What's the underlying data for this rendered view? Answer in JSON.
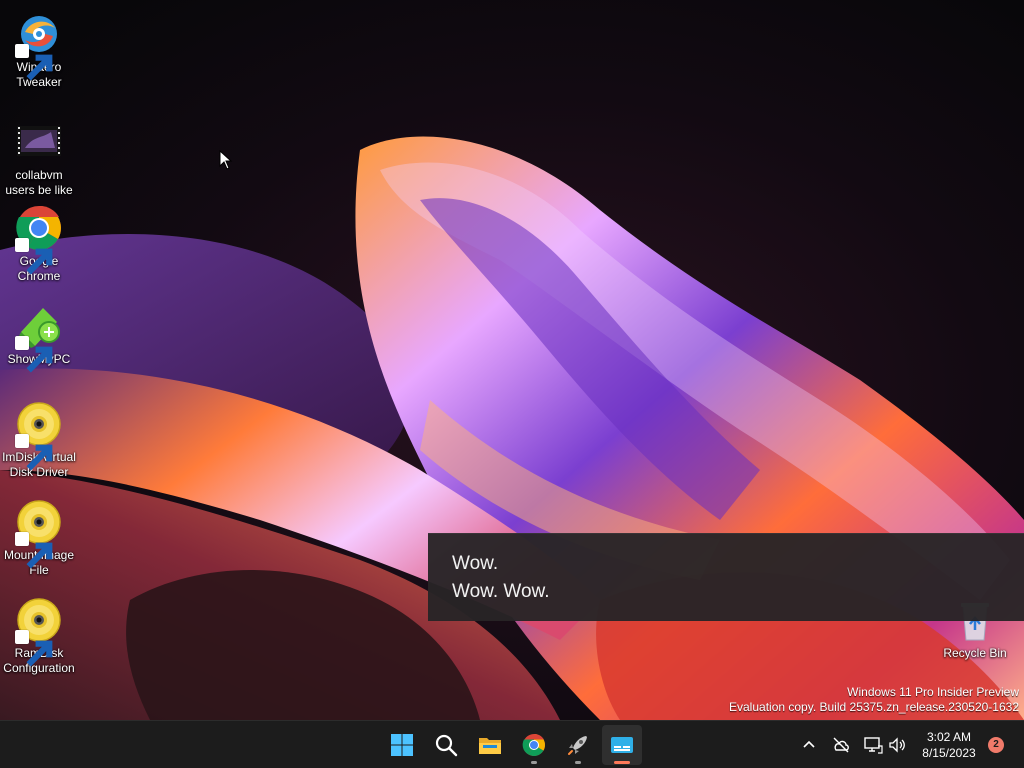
{
  "desktop": {
    "icons": [
      {
        "name": "winaero-tweaker",
        "label": "Winaero\nTweaker",
        "icon": "winaero-tweaker-icon"
      },
      {
        "name": "collabvm-video",
        "label": "collabvm\nusers be like",
        "icon": "video-thumbnail-icon"
      },
      {
        "name": "google-chrome",
        "label": "Google\nChrome",
        "icon": "chrome-icon"
      },
      {
        "name": "showmypc",
        "label": "ShowMyPC",
        "icon": "showmypc-icon"
      },
      {
        "name": "imdisk-virtual-disk-driver",
        "label": "ImDisk Virtual\nDisk Driver",
        "icon": "disc-icon"
      },
      {
        "name": "mount-image-file",
        "label": "Mount Image\nFile",
        "icon": "disc-icon"
      },
      {
        "name": "ramdisk-configuration",
        "label": "RamDisk\nConfiguration",
        "icon": "disc-icon"
      }
    ],
    "recycle_bin": {
      "label": "Recycle Bin",
      "icon": "recycle-bin-icon"
    }
  },
  "caption": {
    "line1": "Wow.",
    "line2": "Wow. Wow."
  },
  "watermark": {
    "line1": "Windows 11 Pro Insider Preview",
    "line2": "Evaluation copy. Build 25375.zn_release.230520-1632"
  },
  "taskbar": {
    "apps": [
      {
        "name": "start",
        "icon": "windows-start-icon"
      },
      {
        "name": "search",
        "icon": "search-icon"
      },
      {
        "name": "file-explorer",
        "icon": "folder-icon"
      },
      {
        "name": "chrome",
        "icon": "chrome-icon"
      },
      {
        "name": "rocket-app",
        "icon": "rocket-icon"
      },
      {
        "name": "live-captions",
        "icon": "live-captions-icon",
        "active": true
      }
    ],
    "tray": {
      "icons": [
        "chevron-up-icon",
        "cloud-offline-icon",
        "network-icon",
        "volume-icon"
      ],
      "time": "3:02 AM",
      "date": "8/15/2023",
      "notifications": "2"
    }
  },
  "colors": {
    "taskbar_bg": "#1c1c1c",
    "accent_indicator": "#ff7a5a",
    "notification_badge": "#f07a6a",
    "chrome_red": "#db4437",
    "chrome_yellow": "#f4b400",
    "chrome_green": "#0f9d58",
    "chrome_blue": "#4285f4"
  }
}
